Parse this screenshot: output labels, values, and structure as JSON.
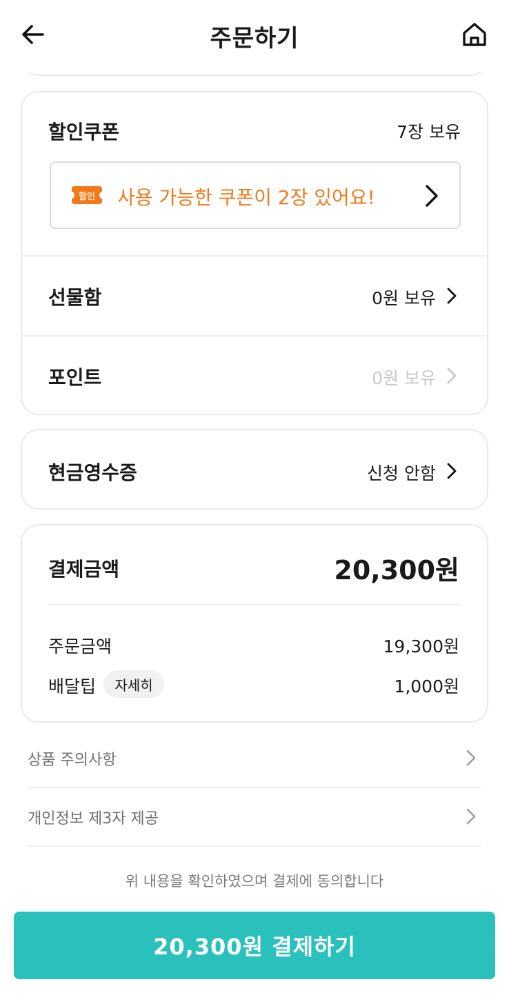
{
  "header": {
    "title": "주문하기",
    "back_icon": "arrow-left-icon",
    "home_icon": "home-icon"
  },
  "discount": {
    "coupon_label": "할인쿠폰",
    "coupon_owned": "7장 보유",
    "coupon_badge": "할인",
    "coupon_available": "사용 가능한 쿠폰이 2장 있어요!",
    "gift_label": "선물함",
    "gift_value": "0원 보유",
    "point_label": "포인트",
    "point_value": "0원 보유"
  },
  "cash_receipt": {
    "label": "현금영수증",
    "value": "신청 안함"
  },
  "payment": {
    "label": "결제금액",
    "total": "20,300원",
    "order_label": "주문금액",
    "order_amount": "19,300원",
    "delivery_label": "배달팁",
    "detail_label": "자세히",
    "delivery_amount": "1,000원"
  },
  "links": [
    {
      "label": "상품 주의사항"
    },
    {
      "label": "개인정보 제3자 제공"
    }
  ],
  "consent_text": "위 내용을 확인하였으며 결제에 동의합니다",
  "pay_button": "20,300원 결제하기",
  "colors": {
    "accent": "#2ac1bc",
    "coupon": "#f07a1a",
    "muted": "#c8c8c8"
  }
}
